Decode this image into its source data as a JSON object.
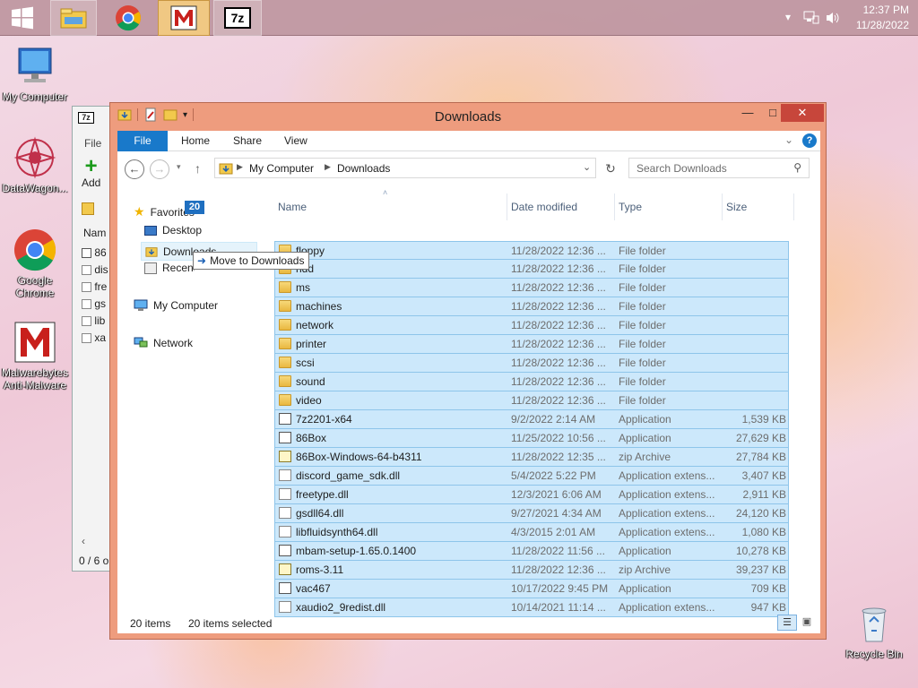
{
  "taskbar": {
    "apps": [
      {
        "name": "file-explorer-icon"
      },
      {
        "name": "chrome-icon"
      },
      {
        "name": "malwarebytes-icon"
      },
      {
        "name": "7zip-icon",
        "label": "7z"
      }
    ],
    "clock": {
      "time": "12:37 PM",
      "date": "11/28/2022"
    }
  },
  "desktop": {
    "icons": [
      {
        "label": "My Computer"
      },
      {
        "label": "DataWagon..."
      },
      {
        "label": "Google Chrome"
      },
      {
        "label": "Malwarebytes Anti-Malware"
      },
      {
        "label": "Recycle Bin"
      }
    ]
  },
  "sevenzip_window": {
    "menu": "File",
    "add_label": "Add",
    "col_name": "Nam",
    "items": [
      "86",
      "dis",
      "fre",
      "gs",
      "lib",
      "xa"
    ],
    "status": "0 / 6 o"
  },
  "explorer": {
    "title": "Downloads",
    "ribbon_tabs": [
      "File",
      "Home",
      "Share",
      "View"
    ],
    "address": {
      "root": "My Computer",
      "current": "Downloads"
    },
    "search_placeholder": "Search Downloads",
    "nav": {
      "favorites": "Favorites",
      "desktop": "Desktop",
      "downloads": "Downloads",
      "recent": "Recent places",
      "my_computer": "My Computer",
      "network": "Network"
    },
    "columns": {
      "name": "Name",
      "date": "Date modified",
      "type": "Type",
      "size": "Size"
    },
    "files": [
      {
        "name": "floppy",
        "date": "11/28/2022 12:36 ...",
        "type": "File folder",
        "size": "",
        "kind": "folder"
      },
      {
        "name": "hdd",
        "date": "11/28/2022 12:36 ...",
        "type": "File folder",
        "size": "",
        "kind": "folder"
      },
      {
        "name": "ms",
        "date": "11/28/2022 12:36 ...",
        "type": "File folder",
        "size": "",
        "kind": "folder"
      },
      {
        "name": "machines",
        "date": "11/28/2022 12:36 ...",
        "type": "File folder",
        "size": "",
        "kind": "folder"
      },
      {
        "name": "network",
        "date": "11/28/2022 12:36 ...",
        "type": "File folder",
        "size": "",
        "kind": "folder"
      },
      {
        "name": "printer",
        "date": "11/28/2022 12:36 ...",
        "type": "File folder",
        "size": "",
        "kind": "folder"
      },
      {
        "name": "scsi",
        "date": "11/28/2022 12:36 ...",
        "type": "File folder",
        "size": "",
        "kind": "folder"
      },
      {
        "name": "sound",
        "date": "11/28/2022 12:36 ...",
        "type": "File folder",
        "size": "",
        "kind": "folder"
      },
      {
        "name": "video",
        "date": "11/28/2022 12:36 ...",
        "type": "File folder",
        "size": "",
        "kind": "folder"
      },
      {
        "name": "7z2201-x64",
        "date": "9/2/2022 2:14 AM",
        "type": "Application",
        "size": "1,539 KB",
        "kind": "app"
      },
      {
        "name": "86Box",
        "date": "11/25/2022 10:56 ...",
        "type": "Application",
        "size": "27,629 KB",
        "kind": "app"
      },
      {
        "name": "86Box-Windows-64-b4311",
        "date": "11/28/2022 12:35 ...",
        "type": "zip Archive",
        "size": "27,784 KB",
        "kind": "zip"
      },
      {
        "name": "discord_game_sdk.dll",
        "date": "5/4/2022 5:22 PM",
        "type": "Application extens...",
        "size": "3,407 KB",
        "kind": "dll"
      },
      {
        "name": "freetype.dll",
        "date": "12/3/2021 6:06 AM",
        "type": "Application extens...",
        "size": "2,911 KB",
        "kind": "dll"
      },
      {
        "name": "gsdll64.dll",
        "date": "9/27/2021 4:34 AM",
        "type": "Application extens...",
        "size": "24,120 KB",
        "kind": "dll"
      },
      {
        "name": "libfluidsynth64.dll",
        "date": "4/3/2015 2:01 AM",
        "type": "Application extens...",
        "size": "1,080 KB",
        "kind": "dll"
      },
      {
        "name": "mbam-setup-1.65.0.1400",
        "date": "11/28/2022 11:56 ...",
        "type": "Application",
        "size": "10,278 KB",
        "kind": "app"
      },
      {
        "name": "roms-3.11",
        "date": "11/28/2022 12:36 ...",
        "type": "zip Archive",
        "size": "39,237 KB",
        "kind": "zip"
      },
      {
        "name": "vac467",
        "date": "10/17/2022 9:45 PM",
        "type": "Application",
        "size": "709 KB",
        "kind": "app"
      },
      {
        "name": "xaudio2_9redist.dll",
        "date": "10/14/2021 11:14 ...",
        "type": "Application extens...",
        "size": "947 KB",
        "kind": "dll"
      }
    ],
    "status": {
      "count": "20 items",
      "selected": "20 items selected"
    }
  },
  "drag": {
    "count": "20",
    "tooltip": "Move to Downloads"
  }
}
